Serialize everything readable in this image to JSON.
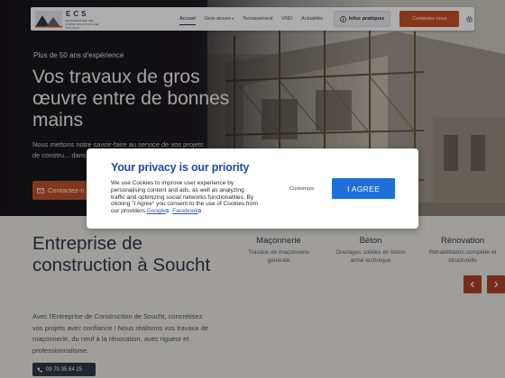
{
  "header": {
    "logo": "ECS",
    "logo_sub": "ENTREPRISE DE CONSTRUCTION DE SOUCHT",
    "nav": {
      "accueil": "Accueil",
      "gros_oeuvre": "Gros œuvre",
      "terrassement": "Terrassement",
      "vrd": "VRD",
      "actualites": "Actualités"
    },
    "infos_label": "Infos pratiques",
    "contact_label": "Contactez-nous"
  },
  "hero": {
    "kicker": "Plus de 50 ans d'expérience",
    "title": "Vos travaux de gros œuvre entre de bonnes mains",
    "text": "Nous mettons notre savoir-faire au service de vos projets de constru... dans les localit...",
    "cta_label": "Contactez-n..."
  },
  "section": {
    "title": "Entreprise de construction à Soucht",
    "text": "Avec l'Entreprise de Construction de Soucht, concrétisez vos projets avec confiance ! Nous réalisons vos travaux de maçonnerie, du neuf à la rénovation, avec rigueur et professionnalisme.",
    "phone": "09 70 35 64 25"
  },
  "services": [
    {
      "title": "Maçonnerie",
      "desc": "Travaux de maçonnerie générale"
    },
    {
      "title": "Béton",
      "desc": "Ouvrages solides en béton armé technique"
    },
    {
      "title": "Rénovation",
      "desc": "Réhabilitation complète et structurelle"
    }
  ],
  "modal": {
    "title": "Your privacy is our priority",
    "text": "We use Cookies to improve user experience by personalising content and ads, as well as analyzing traffic and optimizing social networks functionalities. By clicking \"I Agree\" you consent to the use of Cookies from our providers",
    "link_google": "Google",
    "link_facebook": "Facebook",
    "customize_label": "Customize",
    "agree_label": "I AGREE"
  },
  "colors": {
    "accent": "#c4512a",
    "navy": "#2d3846",
    "modal_title": "#1f4aa8",
    "agree": "#1e6fd9"
  },
  "icons": [
    "gear-icon",
    "info-icon",
    "mail-icon",
    "phone-icon",
    "arrow-left-icon",
    "arrow-right-icon",
    "external-link-icon"
  ]
}
